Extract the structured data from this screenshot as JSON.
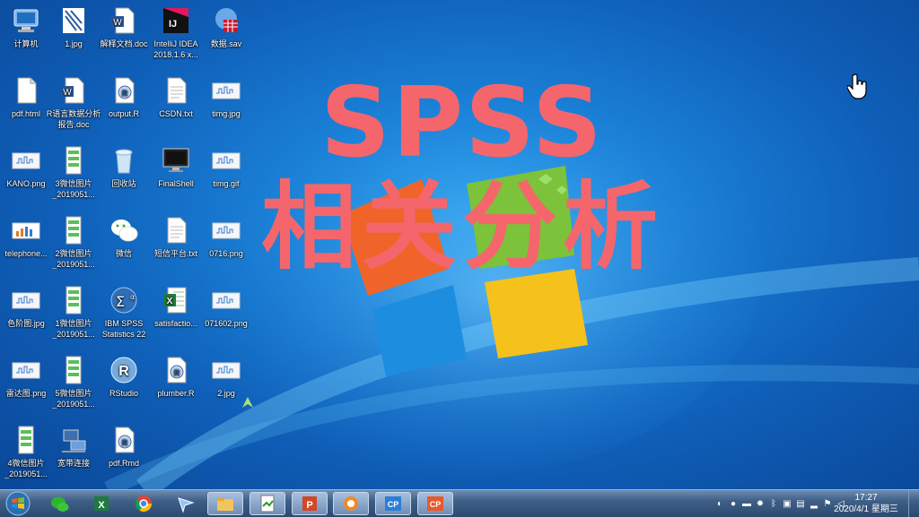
{
  "desktop": {
    "icons": [
      {
        "label": "计算机",
        "kind": "computer"
      },
      {
        "label": "1.jpg",
        "kind": "image-grid"
      },
      {
        "label": "解释文档.doc",
        "kind": "word"
      },
      {
        "label": "IntelliJ IDEA 2018.1.6 x...",
        "kind": "intellij"
      },
      {
        "label": "数据.sav",
        "kind": "sav"
      },
      {
        "label": "pdf.html",
        "kind": "blank-doc"
      },
      {
        "label": "R语言数据分析报告.doc",
        "kind": "word"
      },
      {
        "label": "output.R",
        "kind": "r-file"
      },
      {
        "label": "CSDN.txt",
        "kind": "txt"
      },
      {
        "label": "timg.jpg",
        "kind": "image-thumb"
      },
      {
        "label": "KANO.png",
        "kind": "image-thumb"
      },
      {
        "label": "3微信图片_2019051...",
        "kind": "phone-image"
      },
      {
        "label": "回收站",
        "kind": "recycle-bin"
      },
      {
        "label": "FinalShell",
        "kind": "monitor"
      },
      {
        "label": "timg.gif",
        "kind": "image-thumb"
      },
      {
        "label": "telephone...",
        "kind": "image-chart"
      },
      {
        "label": "2微信图片_2019051...",
        "kind": "phone-image"
      },
      {
        "label": "微信",
        "kind": "wechat"
      },
      {
        "label": "短信平台.txt",
        "kind": "txt"
      },
      {
        "label": "0716.png",
        "kind": "image-thumb"
      },
      {
        "label": "色阶图.jpg",
        "kind": "image-thumb"
      },
      {
        "label": "1微信图片_2019051...",
        "kind": "phone-image"
      },
      {
        "label": "IBM SPSS Statistics 22",
        "kind": "spss"
      },
      {
        "label": "satisfactio...",
        "kind": "excel"
      },
      {
        "label": "071602.png",
        "kind": "image-thumb"
      },
      {
        "label": "雷达图.png",
        "kind": "image-thumb"
      },
      {
        "label": "5微信图片_2019051...",
        "kind": "phone-image"
      },
      {
        "label": "RStudio",
        "kind": "rstudio"
      },
      {
        "label": "plumber.R",
        "kind": "r-file"
      },
      {
        "label": "2.jpg",
        "kind": "image-thumb"
      },
      {
        "label": "4微信图片_2019051...",
        "kind": "phone-image"
      },
      {
        "label": "宽带连接",
        "kind": "network"
      },
      {
        "label": "pdf.Rmd",
        "kind": "r-file"
      }
    ]
  },
  "overlay": {
    "line1": "SPSS",
    "line2": "相关分析"
  },
  "taskbar": {
    "start_icon": "windows-start-icon",
    "apps": [
      {
        "name": "wechat-icon"
      },
      {
        "name": "excel-icon"
      },
      {
        "name": "chrome-icon"
      },
      {
        "name": "feishu-icon"
      },
      {
        "name": "file-explorer-icon",
        "active": true
      },
      {
        "name": "notepad-icon",
        "active": true
      },
      {
        "name": "powerpoint-icon",
        "active": true
      },
      {
        "name": "capture-icon",
        "active": true
      },
      {
        "name": "camtasia-cp-blue-icon",
        "active": true
      },
      {
        "name": "camtasia-cp-orange-icon",
        "active": true
      }
    ],
    "clock": {
      "time": "17:27",
      "date": "2020/4/1 星期三"
    }
  },
  "colors": {
    "overlay_text": "#f4666c",
    "desktop": "#1a7fd6",
    "taskbar": "#3f5f86"
  }
}
